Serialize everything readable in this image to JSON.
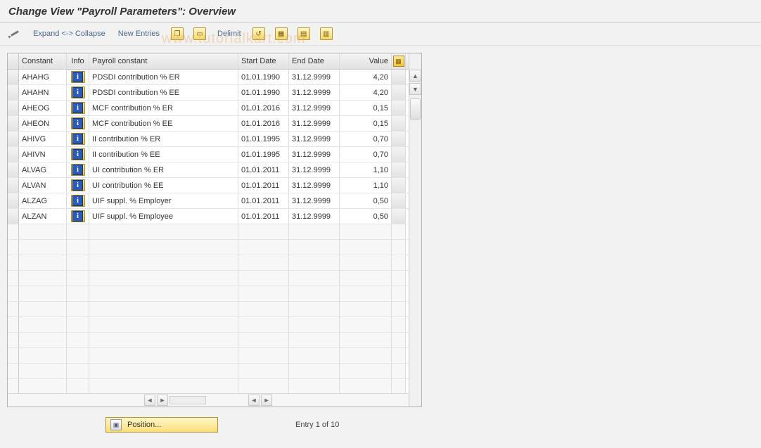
{
  "title": "Change View \"Payroll Parameters\": Overview",
  "toolbar": {
    "expand_collapse": "Expand <-> Collapse",
    "new_entries": "New Entries",
    "delimit": "Delimit"
  },
  "columns": {
    "constant": "Constant",
    "info": "Info",
    "payroll_constant": "Payroll constant",
    "start_date": "Start Date",
    "end_date": "End Date",
    "value": "Value"
  },
  "rows": [
    {
      "const": "AHAHG",
      "pc": "PDSDI contribution % ER",
      "sd": "01.01.1990",
      "ed": "31.12.9999",
      "val": "4,20"
    },
    {
      "const": "AHAHN",
      "pc": "PDSDI contribution % EE",
      "sd": "01.01.1990",
      "ed": "31.12.9999",
      "val": "4,20"
    },
    {
      "const": "AHEOG",
      "pc": "MCF contribution % ER",
      "sd": "01.01.2016",
      "ed": "31.12.9999",
      "val": "0,15"
    },
    {
      "const": "AHEON",
      "pc": "MCF contribution % EE",
      "sd": "01.01.2016",
      "ed": "31.12.9999",
      "val": "0,15"
    },
    {
      "const": "AHIVG",
      "pc": "II contribution % ER",
      "sd": "01.01.1995",
      "ed": "31.12.9999",
      "val": "0,70"
    },
    {
      "const": "AHIVN",
      "pc": "II contribution % EE",
      "sd": "01.01.1995",
      "ed": "31.12.9999",
      "val": "0,70"
    },
    {
      "const": "ALVAG",
      "pc": "UI contribution % ER",
      "sd": "01.01.2011",
      "ed": "31.12.9999",
      "val": "1,10"
    },
    {
      "const": "ALVAN",
      "pc": "UI contribution % EE",
      "sd": "01.01.2011",
      "ed": "31.12.9999",
      "val": "1,10"
    },
    {
      "const": "ALZAG",
      "pc": "UIF suppl. %     Employer",
      "sd": "01.01.2011",
      "ed": "31.12.9999",
      "val": "0,50"
    },
    {
      "const": "ALZAN",
      "pc": "UIF suppl. %     Employee",
      "sd": "01.01.2011",
      "ed": "31.12.9999",
      "val": "0,50"
    }
  ],
  "footer": {
    "position_label": "Position...",
    "entry_status": "Entry 1 of 10"
  },
  "watermark": "www.tutorialkart.com",
  "icons": {
    "info_glyph": "i"
  }
}
